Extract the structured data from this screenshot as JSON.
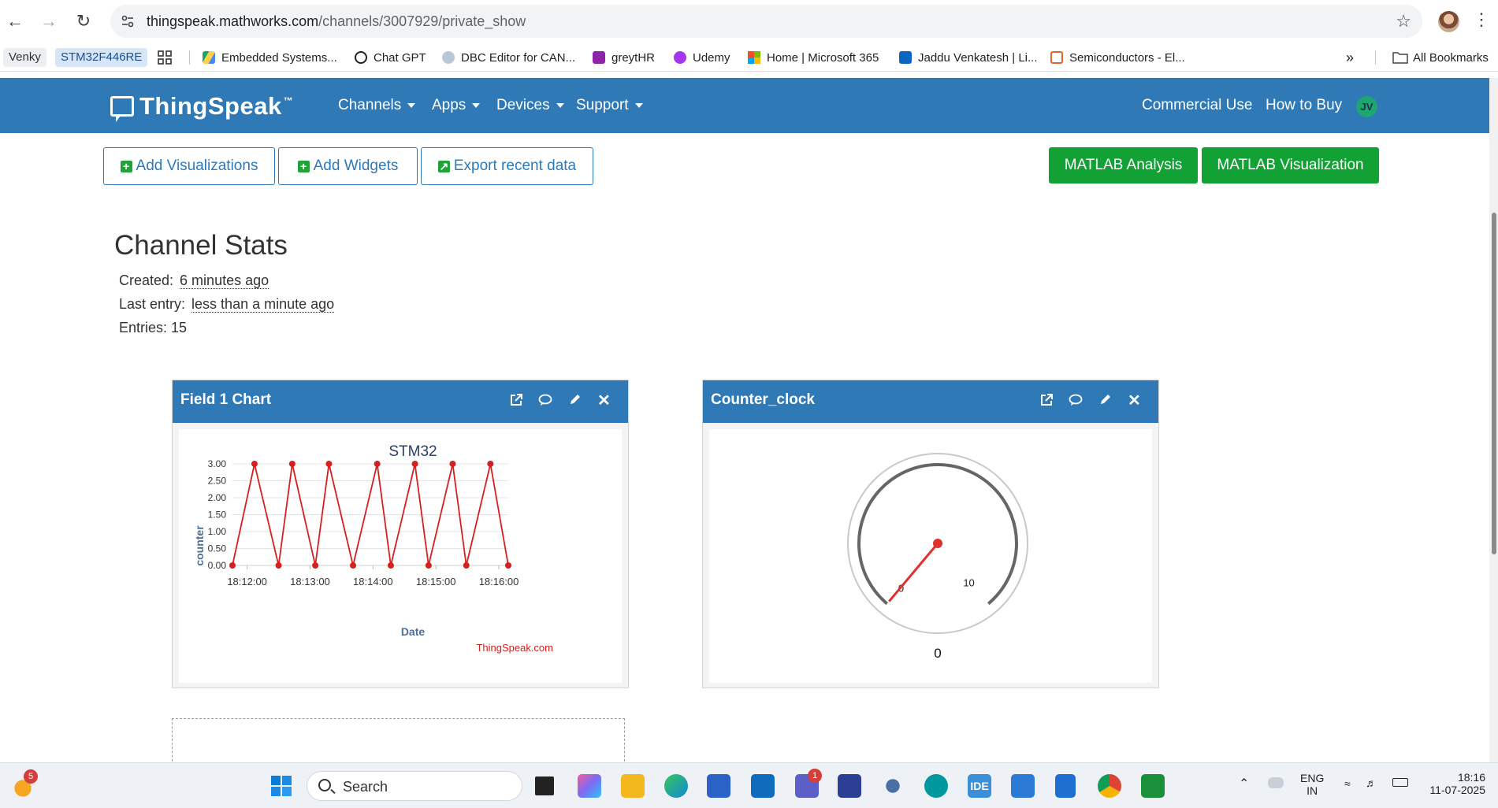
{
  "browser": {
    "url_domain": "thingspeak.mathworks.com",
    "url_path": "/channels/3007929/private_show",
    "bookmarks": [
      {
        "label": "Venky",
        "icon": "chip"
      },
      {
        "label": "STM32F446RE",
        "icon": "chip"
      },
      {
        "label": "",
        "icon": "apps-grid-icon"
      },
      {
        "label": "Embedded Systems...",
        "icon": "drive-icon"
      },
      {
        "label": "Chat GPT",
        "icon": "openai-icon"
      },
      {
        "label": "DBC Editor for CAN...",
        "icon": "link-icon"
      },
      {
        "label": "greytHR",
        "icon": "greythr-icon"
      },
      {
        "label": "Udemy",
        "icon": "udemy-icon"
      },
      {
        "label": "Home | Microsoft 365",
        "icon": "microsoft-icon"
      },
      {
        "label": "Jaddu Venkatesh | Li...",
        "icon": "linkedin-icon"
      },
      {
        "label": "Semiconductors - El...",
        "icon": "chip-icon"
      }
    ],
    "more": "»",
    "all_bookmarks": "All Bookmarks"
  },
  "nav": {
    "brand": "ThingSpeak",
    "tm": "™",
    "menus": [
      "Channels",
      "Apps",
      "Devices",
      "Support"
    ],
    "right": [
      "Commercial Use",
      "How to Buy"
    ],
    "avatar": "JV"
  },
  "actions": {
    "add_visualizations": "Add Visualizations",
    "add_widgets": "Add Widgets",
    "export": "Export recent data",
    "matlab_analysis": "MATLAB Analysis",
    "matlab_visualization": "MATLAB Visualization"
  },
  "stats": {
    "title": "Channel Stats",
    "created_label": "Created:",
    "created_value": "6 minutes ago",
    "last_entry_label": "Last entry:",
    "last_entry_value": "less than a minute ago",
    "entries": "Entries: 15"
  },
  "panels": {
    "field1_title": "Field 1 Chart",
    "gauge_title": "Counter_clock"
  },
  "chart_data": {
    "type": "line",
    "title": "STM32",
    "xlabel": "Date",
    "ylabel": "counter",
    "credit": "ThingSpeak.com",
    "color": "#d62020",
    "ylim": [
      0,
      3
    ],
    "y_ticks": [
      "0.00",
      "0.50",
      "1.00",
      "1.50",
      "2.00",
      "2.50",
      "3.00"
    ],
    "x_ticks": [
      "18:12:00",
      "18:13:00",
      "18:14:00",
      "18:15:00",
      "18:16:00"
    ],
    "x_range_seconds": [
      "18:11:46",
      "18:16:09"
    ],
    "x": [
      "18:11:46",
      "18:12:07",
      "18:12:30",
      "18:12:43",
      "18:13:05",
      "18:13:18",
      "18:13:41",
      "18:14:04",
      "18:14:17",
      "18:14:40",
      "18:14:53",
      "18:15:16",
      "18:15:29",
      "18:15:52",
      "18:16:09"
    ],
    "series": [
      {
        "values": [
          0,
          3,
          0,
          3,
          0,
          3,
          0,
          3,
          0,
          3,
          0,
          3,
          0,
          3,
          0
        ]
      }
    ]
  },
  "gauge": {
    "min_label": "0",
    "max_label": "10",
    "value": 0,
    "value_label": "0",
    "min": 0,
    "max": 10
  },
  "taskbar": {
    "search": "Search",
    "weather_badge": "5",
    "teams_badge": "1",
    "lang_top": "ENG",
    "lang_bottom": "IN",
    "time": "18:16",
    "date": "11-07-2025"
  }
}
